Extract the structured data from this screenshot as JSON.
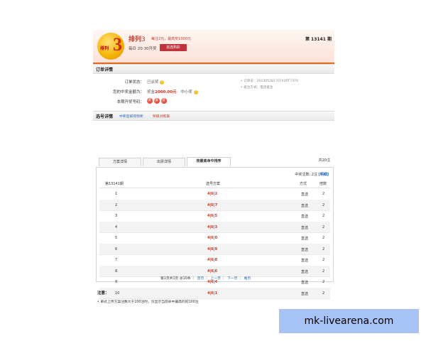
{
  "header": {
    "logo_number": "3",
    "logo_text": "排列",
    "game_name": "排列",
    "game_num": "3",
    "subtitle": "每注2元，最高奖1000元",
    "draw_time": "每日 20:30开奖",
    "continue_button": "追连购彩",
    "issue": "第 13141 期"
  },
  "order_section": {
    "title": "订单详情",
    "status_label": "订单状态：",
    "status_value": "已派奖",
    "prize_label": "您的中奖金额为：",
    "prize_prefix": "奖金",
    "prize_amount": "2000.00元",
    "prize_level": "中小奖",
    "numbers_label": "本期开奖号码：",
    "numbers": [
      "4",
      "6",
      "2"
    ],
    "order_no": "• 订单号：2013052817CF035T7379",
    "purchase_method": "• 投注方式：电话投注"
  },
  "selection_section": {
    "title": "选号详情",
    "link_1": "中奖后如何领奖",
    "link_2": "奖级对照表"
  },
  "tabs": [
    {
      "label": "方案详情"
    },
    {
      "label": "出票详情"
    },
    {
      "label": "按最高命中排序"
    }
  ],
  "total_count": "共20注",
  "win_summary": {
    "text": "中奖注数: 2注",
    "link": "[明细]"
  },
  "table": {
    "headers": [
      "第13141期",
      "选号方案",
      "方式",
      "倍数"
    ],
    "rows": [
      {
        "index": "1",
        "code": "4|6|2",
        "method": "直选",
        "multiple": "2"
      },
      {
        "index": "2",
        "code": "4|6|7",
        "method": "直选",
        "multiple": "2"
      },
      {
        "index": "3",
        "code": "4|6|5",
        "method": "直选",
        "multiple": "2"
      },
      {
        "index": "4",
        "code": "4|6|3",
        "method": "直选",
        "multiple": "2"
      },
      {
        "index": "5",
        "code": "4|6|0",
        "method": "直选",
        "multiple": "2"
      },
      {
        "index": "6",
        "code": "4|6|9",
        "method": "直选",
        "multiple": "2"
      },
      {
        "index": "7",
        "code": "4|6|8",
        "method": "直选",
        "multiple": "2"
      },
      {
        "index": "8",
        "code": "4|6|6",
        "method": "直选",
        "multiple": "2"
      },
      {
        "index": "9",
        "code": "4|6|4",
        "method": "直选",
        "multiple": "2"
      },
      {
        "index": "10",
        "code": "4|6|1",
        "method": "直选",
        "multiple": "2"
      }
    ]
  },
  "pager": {
    "info": "第1页共1页 总10条",
    "first": "首页",
    "prev": "上一页",
    "next": "下一页",
    "last": "尾页"
  },
  "notes": {
    "title": "注意：",
    "item_1": "• 单式上传方案注数大于100注时，仅显示当前命中最高的前100注"
  },
  "watermark": "mk-livearena.com"
}
